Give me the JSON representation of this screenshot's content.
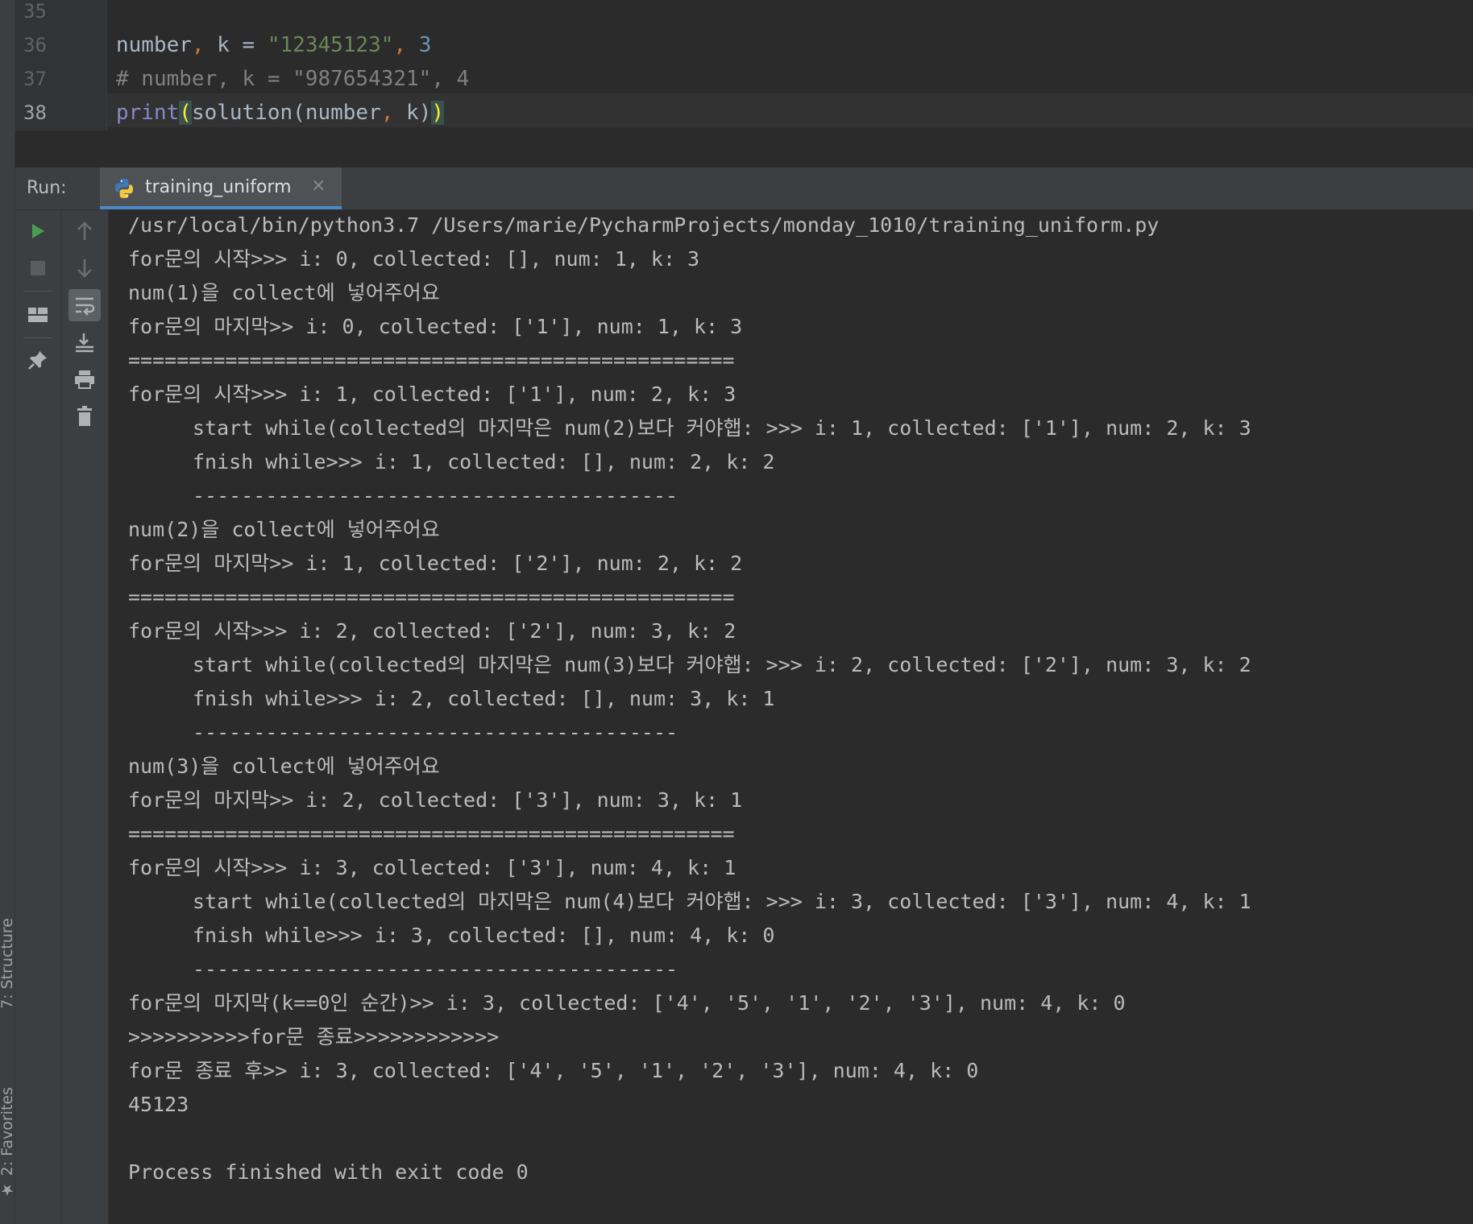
{
  "editor": {
    "lines": [
      {
        "number": "35",
        "tokens": []
      },
      {
        "number": "36",
        "tokens": [
          {
            "text": "number",
            "cls": ""
          },
          {
            "text": ",",
            "cls": "tk-kw"
          },
          {
            "text": " k = ",
            "cls": ""
          },
          {
            "text": "\"12345123\"",
            "cls": "tk-str"
          },
          {
            "text": ",",
            "cls": "tk-kw"
          },
          {
            "text": " ",
            "cls": ""
          },
          {
            "text": "3",
            "cls": "tk-num"
          }
        ]
      },
      {
        "number": "37",
        "tokens": [
          {
            "text": "# number, k = \"987654321\", 4",
            "cls": "tk-cm"
          }
        ]
      },
      {
        "number": "38",
        "tokens": [
          {
            "text": "print",
            "cls": "tk-builtin"
          },
          {
            "text": "(",
            "cls": "tk-paren-match"
          },
          {
            "text": "solution(number",
            "cls": ""
          },
          {
            "text": ",",
            "cls": "tk-kw"
          },
          {
            "text": " k)",
            "cls": ""
          },
          {
            "text": ")",
            "cls": "tk-paren-match"
          }
        ]
      }
    ]
  },
  "run_window": {
    "label": "Run:",
    "tab_label": "training_uniform",
    "close_glyph": "×",
    "tab_icon": "python-icon"
  },
  "side_tabs": {
    "structure": "7: Structure",
    "favorites": "2: Favorites"
  },
  "toolbar_icons": {
    "column1": [
      "run-icon",
      "stop-icon",
      "layout-icon",
      "pin-icon"
    ],
    "column2": [
      "up-arrow-icon",
      "down-arrow-icon",
      "soft-wrap-icon",
      "scroll-to-end-icon",
      "print-icon",
      "trash-icon"
    ]
  },
  "colors": {
    "background": "#2b2b2b",
    "panel": "#3c3f41",
    "run_green": "#499c54",
    "tab_underline": "#4a88c7",
    "console_text": "#bbbbbb"
  },
  "console": {
    "lines": [
      {
        "text": "/usr/local/bin/python3.7 /Users/marie/PycharmProjects/monday_1010/training_uniform.py",
        "indent": false
      },
      {
        "text": "for문의 시작>>> i: 0, collected: [], num: 1, k: 3",
        "indent": false
      },
      {
        "text": "num(1)을 collect에 넣어주어요",
        "indent": false
      },
      {
        "text": "for문의 마지막>> i: 0, collected: ['1'], num: 1, k: 3",
        "indent": false
      },
      {
        "text": "==================================================",
        "indent": false
      },
      {
        "text": "for문의 시작>>> i: 1, collected: ['1'], num: 2, k: 3",
        "indent": false
      },
      {
        "text": "start while(collected의 마지막은 num(2)보다 커야햅: >>> i: 1, collected: ['1'], num: 2, k: 3",
        "indent": true
      },
      {
        "text": "fnish while>>> i: 1, collected: [], num: 2, k: 2",
        "indent": true
      },
      {
        "text": "----------------------------------------",
        "indent": true
      },
      {
        "text": "num(2)을 collect에 넣어주어요",
        "indent": false
      },
      {
        "text": "for문의 마지막>> i: 1, collected: ['2'], num: 2, k: 2",
        "indent": false
      },
      {
        "text": "==================================================",
        "indent": false
      },
      {
        "text": "for문의 시작>>> i: 2, collected: ['2'], num: 3, k: 2",
        "indent": false
      },
      {
        "text": "start while(collected의 마지막은 num(3)보다 커야햅: >>> i: 2, collected: ['2'], num: 3, k: 2",
        "indent": true
      },
      {
        "text": "fnish while>>> i: 2, collected: [], num: 3, k: 1",
        "indent": true
      },
      {
        "text": "----------------------------------------",
        "indent": true
      },
      {
        "text": "num(3)을 collect에 넣어주어요",
        "indent": false
      },
      {
        "text": "for문의 마지막>> i: 2, collected: ['3'], num: 3, k: 1",
        "indent": false
      },
      {
        "text": "==================================================",
        "indent": false
      },
      {
        "text": "for문의 시작>>> i: 3, collected: ['3'], num: 4, k: 1",
        "indent": false
      },
      {
        "text": "start while(collected의 마지막은 num(4)보다 커야햅: >>> i: 3, collected: ['3'], num: 4, k: 1",
        "indent": true
      },
      {
        "text": "fnish while>>> i: 3, collected: [], num: 4, k: 0",
        "indent": true
      },
      {
        "text": "----------------------------------------",
        "indent": true
      },
      {
        "text": "for문의 마지막(k==0인 순간)>> i: 3, collected: ['4', '5', '1', '2', '3'], num: 4, k: 0",
        "indent": false
      },
      {
        "text": ">>>>>>>>>>for문 종료>>>>>>>>>>>>",
        "indent": false
      },
      {
        "text": "for문 종료 후>> i: 3, collected: ['4', '5', '1', '2', '3'], num: 4, k: 0",
        "indent": false
      },
      {
        "text": "45123",
        "indent": false
      },
      {
        "text": "",
        "indent": false
      },
      {
        "text": "Process finished with exit code 0",
        "indent": false
      }
    ]
  }
}
